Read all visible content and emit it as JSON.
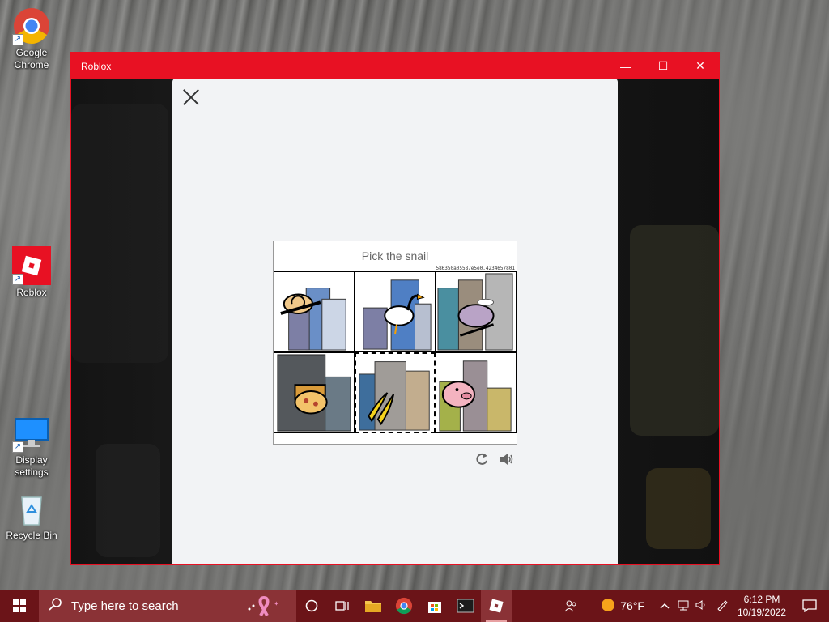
{
  "desktop": {
    "icons": [
      {
        "label_line1": "Google",
        "label_line2": "Chrome"
      },
      {
        "label_line1": "Roblox",
        "label_line2": ""
      },
      {
        "label_line1": "Display",
        "label_line2": "settings"
      },
      {
        "label_line1": "Recycle Bin",
        "label_line2": ""
      }
    ]
  },
  "window": {
    "title": "Roblox",
    "minimize_glyph": "—",
    "maximize_glyph": "☐",
    "close_glyph": "✕"
  },
  "captcha": {
    "prompt": "Pick the snail",
    "id_text": "586350a05587e5e0.4234657801",
    "tiles": [
      {
        "subject": "snail",
        "selected": false
      },
      {
        "subject": "goose",
        "selected": false
      },
      {
        "subject": "hippo",
        "selected": false
      },
      {
        "subject": "pizza",
        "selected": false
      },
      {
        "subject": "banana",
        "selected": true
      },
      {
        "subject": "pig",
        "selected": false
      }
    ],
    "reload_icon": "refresh-icon",
    "audio_icon": "speaker-icon"
  },
  "taskbar": {
    "search_placeholder": "Type here to search",
    "weather_temp": "76°F",
    "time": "6:12 PM",
    "date": "10/19/2022",
    "accent": "#6b1418"
  }
}
